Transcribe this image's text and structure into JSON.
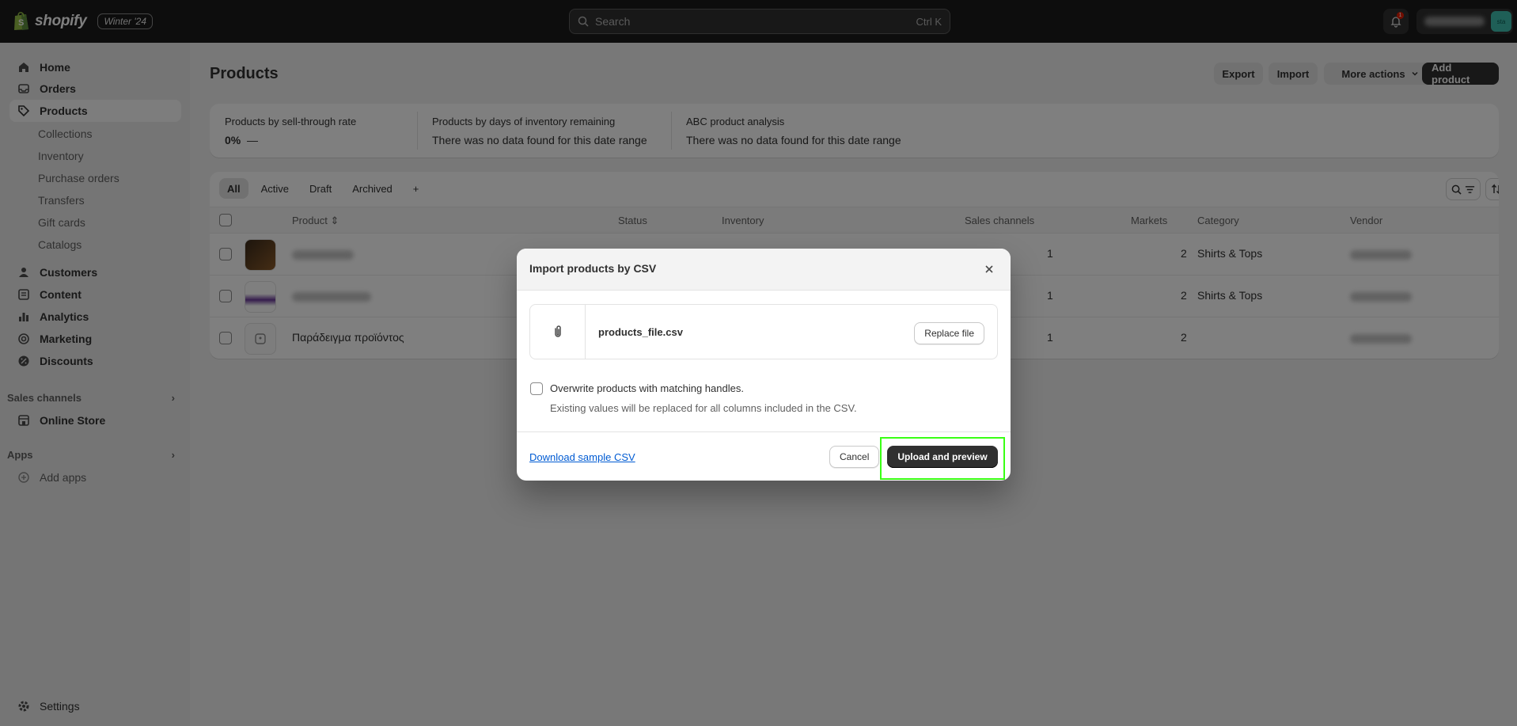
{
  "topbar": {
    "brand": "shopify",
    "edition": "Winter '24",
    "search_placeholder": "Search",
    "search_shortcut": "Ctrl K",
    "notification_count": "1",
    "avatar_initials": "sta"
  },
  "sidebar": {
    "primary": [
      {
        "label": "Home",
        "icon": "home-icon"
      },
      {
        "label": "Orders",
        "icon": "orders-icon"
      },
      {
        "label": "Products",
        "icon": "tag-icon",
        "active": true
      }
    ],
    "product_sub": [
      "Collections",
      "Inventory",
      "Purchase orders",
      "Transfers",
      "Gift cards",
      "Catalogs"
    ],
    "secondary": [
      {
        "label": "Customers",
        "icon": "person-icon"
      },
      {
        "label": "Content",
        "icon": "content-icon"
      },
      {
        "label": "Analytics",
        "icon": "bar-chart-icon"
      },
      {
        "label": "Marketing",
        "icon": "target-icon"
      },
      {
        "label": "Discounts",
        "icon": "discount-icon"
      }
    ],
    "sales_channels_label": "Sales channels",
    "online_store": "Online Store",
    "apps_label": "Apps",
    "add_apps": "Add apps",
    "settings": "Settings"
  },
  "page": {
    "title": "Products",
    "export": "Export",
    "import": "Import",
    "more_actions": "More actions",
    "add_product": "Add product"
  },
  "metrics": [
    {
      "label": "Products by sell-through rate",
      "value": "0%",
      "trend": "—"
    },
    {
      "label": "Products by days of inventory remaining",
      "value": "There was no data found for this date range"
    },
    {
      "label": "ABC product analysis",
      "value": "There was no data found for this date range"
    }
  ],
  "tabs": [
    "All",
    "Active",
    "Draft",
    "Archived",
    "+"
  ],
  "table": {
    "headers": {
      "product": "Product",
      "status": "Status",
      "inventory": "Inventory",
      "sales_channels": "Sales channels",
      "markets": "Markets",
      "category": "Category",
      "vendor": "Vendor"
    },
    "rows": [
      {
        "name": "",
        "sales_channels": "1",
        "markets": "2",
        "category": "Shirts & Tops"
      },
      {
        "name": "",
        "sales_channels": "1",
        "markets": "2",
        "category": "Shirts & Tops"
      },
      {
        "name": "Παράδειγμα προϊόντος",
        "sales_channels": "1",
        "markets": "2",
        "category": ""
      }
    ]
  },
  "modal": {
    "title": "Import products by CSV",
    "file_name": "products_file.csv",
    "replace_file": "Replace file",
    "overwrite_label": "Overwrite products with matching handles.",
    "overwrite_help": "Existing values will be replaced for all columns included in the CSV.",
    "download_sample": "Download sample CSV",
    "cancel": "Cancel",
    "upload": "Upload and preview"
  },
  "colors": {
    "topbar": "#1a1a1a",
    "primary_button": "#303030",
    "link": "#005bd3",
    "highlight": "#39ff14"
  }
}
